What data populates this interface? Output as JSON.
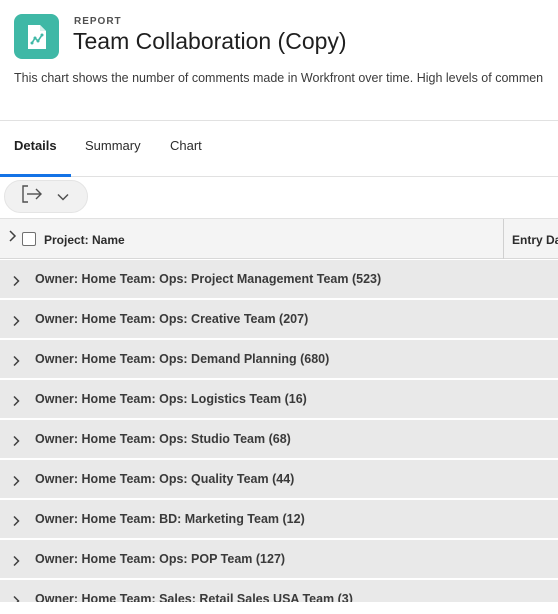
{
  "header": {
    "kind": "REPORT",
    "title": "Team Collaboration (Copy)",
    "description": "This chart shows the number of comments made in Workfront over time. High levels of commen",
    "icon": "report-chart-icon",
    "icon_color": "#3fb8a6"
  },
  "tabs": [
    {
      "label": "Details",
      "active": true
    },
    {
      "label": "Summary",
      "active": false
    },
    {
      "label": "Chart",
      "active": false
    }
  ],
  "toolbar": {
    "export_icon": "export-icon",
    "dropdown_icon": "chevron-down-icon"
  },
  "table": {
    "columns": [
      "Project: Name",
      "Entry Da"
    ],
    "groups": [
      {
        "label": "Owner: Home Team: Ops: Project Management Team (523)"
      },
      {
        "label": "Owner: Home Team: Ops: Creative Team (207)"
      },
      {
        "label": "Owner: Home Team: Ops: Demand Planning (680)"
      },
      {
        "label": "Owner: Home Team: Ops: Logistics Team (16)"
      },
      {
        "label": "Owner: Home Team: Ops: Studio Team (68)"
      },
      {
        "label": "Owner: Home Team: Ops: Quality Team (44)"
      },
      {
        "label": "Owner: Home Team: BD: Marketing Team (12)"
      },
      {
        "label": "Owner: Home Team: Ops: POP Team (127)"
      },
      {
        "label": "Owner: Home Team: Sales: Retail Sales USA Team (3)"
      }
    ]
  },
  "colors": {
    "accent": "#1473e6",
    "row_bg": "#e9e9e9"
  }
}
